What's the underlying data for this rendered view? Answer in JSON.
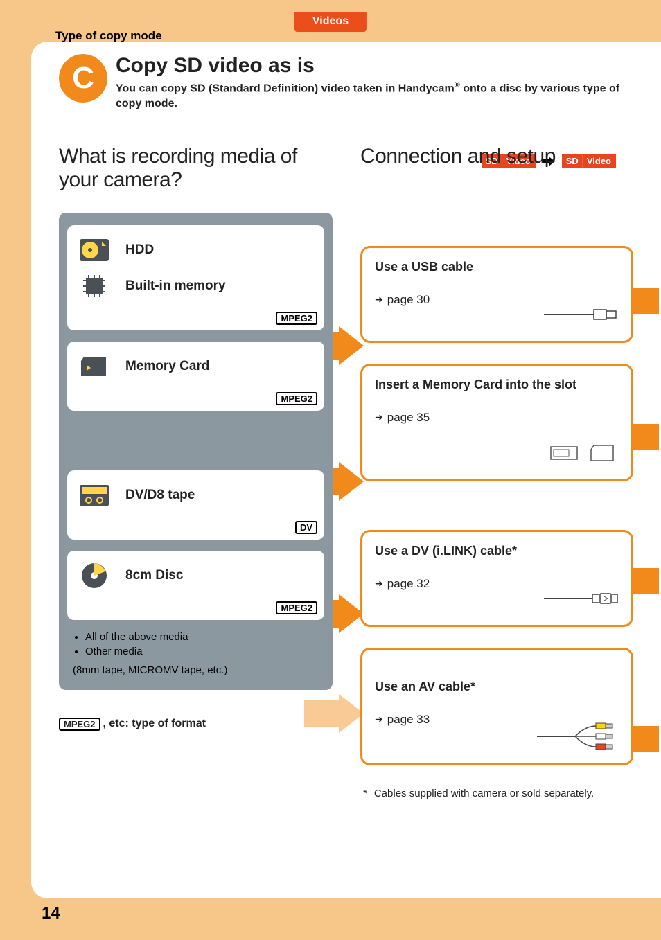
{
  "tab": "Videos",
  "type_label": "Type of copy mode",
  "circle_letter": "C",
  "title": "Copy SD video as is",
  "subtitle_pre": "You can copy SD (Standard Definition) video taken in Handycam",
  "subtitle_post": " onto a disc by various type of copy mode.",
  "sd_badge_left": "SD",
  "sd_badge_right": "Video",
  "col_left_heading": "What is recording media of your camera?",
  "col_right_heading": "Connection and setup",
  "media": {
    "hdd": "HDD",
    "builtin": "Built-in memory",
    "memcard": "Memory Card",
    "tape": "DV/D8 tape",
    "disc": "8cm Disc",
    "fmt_mpeg2": "MPEG2",
    "fmt_dv": "DV"
  },
  "notes": {
    "a": "All of the above media",
    "b": "Other media",
    "b_sub": "(8mm tape, MICROMV tape, etc.)"
  },
  "legend_text": ", etc: type of format",
  "conn": {
    "usb": {
      "title": "Use a USB cable",
      "page": "page 30"
    },
    "mem": {
      "title": "Insert a Memory Card into the slot",
      "page": "page 35"
    },
    "dv": {
      "title": "Use a DV (i.LINK) cable*",
      "page": "page 32"
    },
    "av": {
      "title": "Use an AV cable*",
      "page": "page 33"
    }
  },
  "footnote_mark": "*",
  "footnote_text": "Cables supplied with camera or sold separately.",
  "page_number": "14"
}
